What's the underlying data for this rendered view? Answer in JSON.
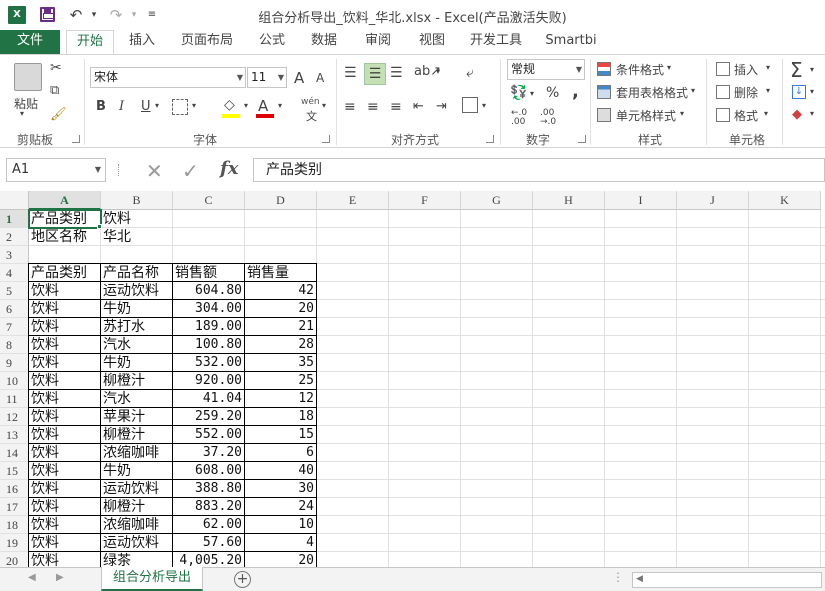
{
  "window": {
    "title": "组合分析导出_饮料_华北.xlsx - Excel(产品激活失败)",
    "logo": "X"
  },
  "tabs": [
    "文件",
    "开始",
    "插入",
    "页面布局",
    "公式",
    "数据",
    "审阅",
    "视图",
    "开发工具",
    "Smartbi"
  ],
  "ribbon": {
    "clipboard": {
      "paste": "粘贴",
      "label": "剪贴板"
    },
    "font": {
      "name": "宋体",
      "size": "11",
      "label": "字体",
      "bold": "B",
      "italic": "I",
      "underline": "U",
      "grow": "A",
      "shrink": "A",
      "wen": "wén"
    },
    "alignment": {
      "label": "对齐方式"
    },
    "number": {
      "format": "常规",
      "label": "数字",
      "percent": "%",
      "comma": ",",
      "inc": "←.0\n.00",
      "dec": ".00\n→.0"
    },
    "styles": {
      "conditional": "条件格式",
      "table": "套用表格格式",
      "cell": "单元格样式",
      "label": "样式"
    },
    "cells": {
      "insert": "插入",
      "delete": "删除",
      "format": "格式",
      "label": "单元格"
    }
  },
  "formula_bar": {
    "name_box": "A1",
    "fx": "fx",
    "content": "产品类别"
  },
  "columns": [
    "A",
    "B",
    "C",
    "D",
    "E",
    "F",
    "G",
    "H",
    "I",
    "J",
    "K"
  ],
  "rows": [
    "1",
    "2",
    "3",
    "4",
    "5",
    "6",
    "7",
    "8",
    "9",
    "10",
    "11",
    "12",
    "13",
    "14",
    "15",
    "16",
    "17",
    "18",
    "19",
    "20"
  ],
  "sheet": {
    "header_rows": [
      [
        "产品类别",
        "饮料"
      ],
      [
        "地区名称",
        "华北"
      ]
    ],
    "table_headers": [
      "产品类别",
      "产品名称",
      "销售额",
      "销售量"
    ],
    "table_rows": [
      [
        "饮料",
        "运动饮料",
        "604.80",
        "42"
      ],
      [
        "饮料",
        "牛奶",
        "304.00",
        "20"
      ],
      [
        "饮料",
        "苏打水",
        "189.00",
        "21"
      ],
      [
        "饮料",
        "汽水",
        "100.80",
        "28"
      ],
      [
        "饮料",
        "牛奶",
        "532.00",
        "35"
      ],
      [
        "饮料",
        "柳橙汁",
        "920.00",
        "25"
      ],
      [
        "饮料",
        "汽水",
        "41.04",
        "12"
      ],
      [
        "饮料",
        "苹果汁",
        "259.20",
        "18"
      ],
      [
        "饮料",
        "柳橙汁",
        "552.00",
        "15"
      ],
      [
        "饮料",
        "浓缩咖啡",
        "37.20",
        "6"
      ],
      [
        "饮料",
        "牛奶",
        "608.00",
        "40"
      ],
      [
        "饮料",
        "运动饮料",
        "388.80",
        "30"
      ],
      [
        "饮料",
        "柳橙汁",
        "883.20",
        "24"
      ],
      [
        "饮料",
        "浓缩咖啡",
        "62.00",
        "10"
      ],
      [
        "饮料",
        "运动饮料",
        "57.60",
        "4"
      ],
      [
        "饮料",
        "绿茶",
        "4,005.20",
        "20"
      ]
    ]
  },
  "sheet_tabs": [
    "组合分析导出"
  ],
  "colors": {
    "accent": "#217346"
  }
}
